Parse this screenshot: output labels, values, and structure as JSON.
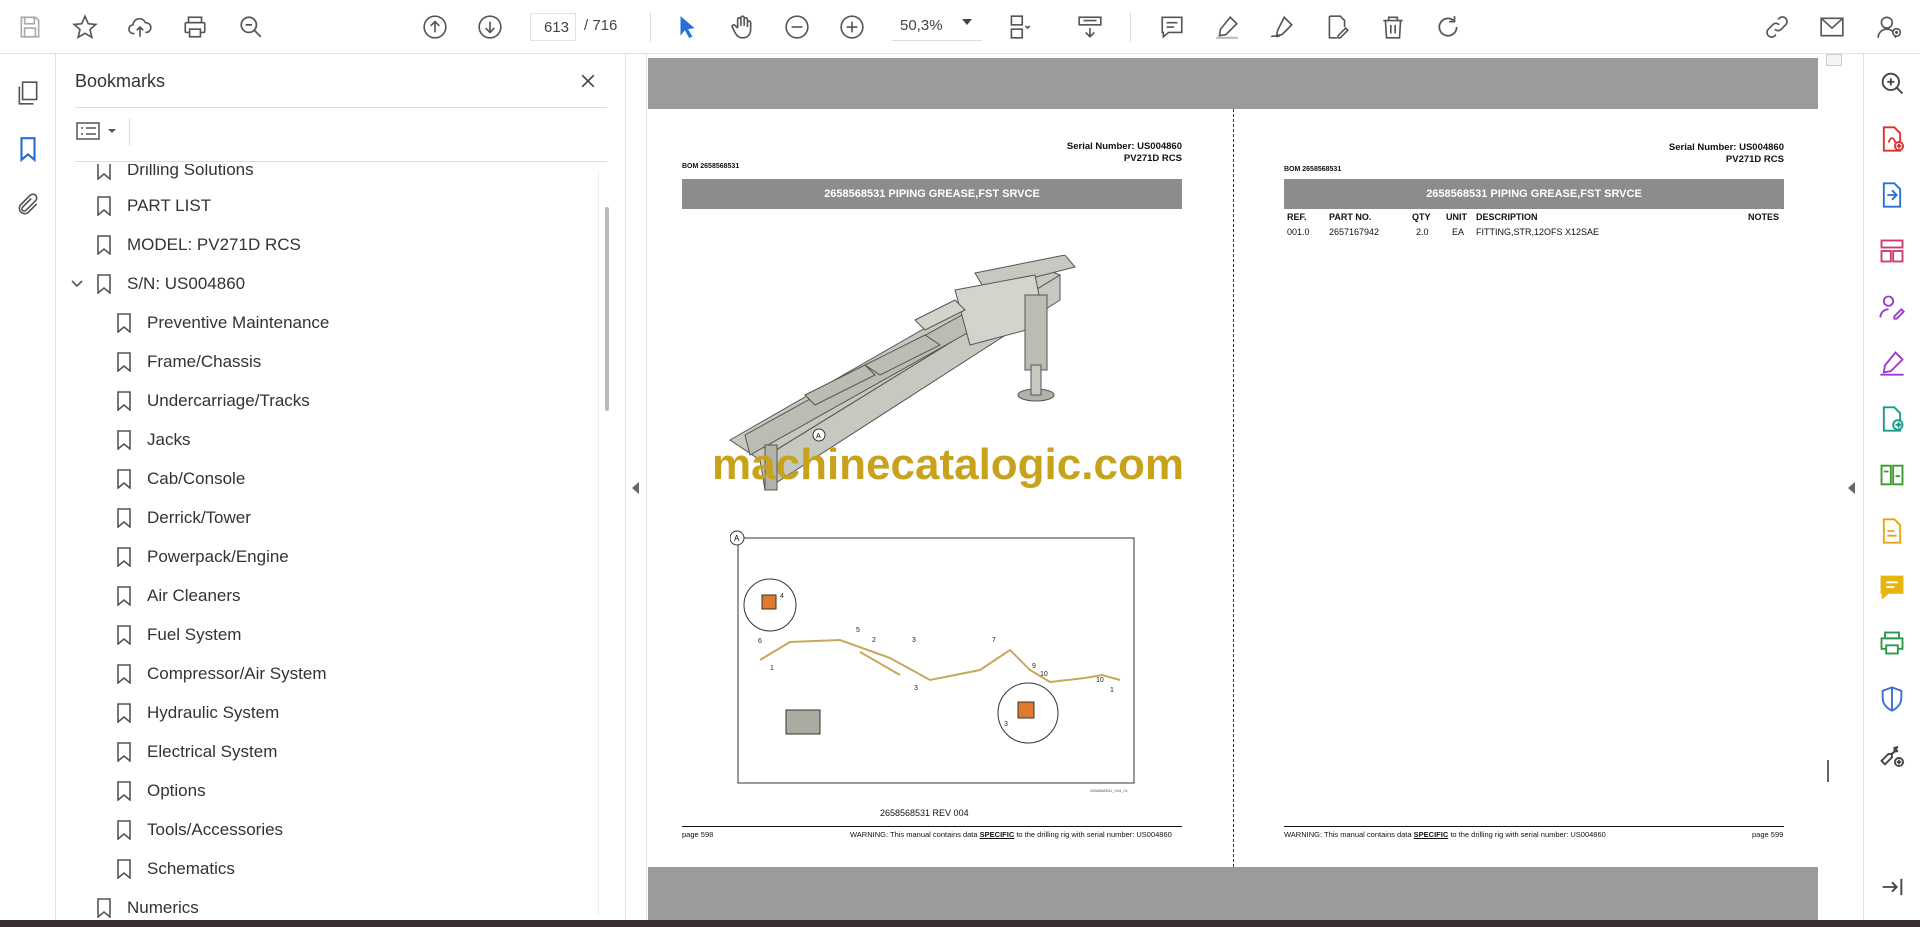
{
  "toolbar": {
    "page_current": "613",
    "page_total": "/ 716",
    "zoom": "50,3%",
    "icons": [
      "save-icon",
      "star-icon",
      "upload-icon",
      "print-icon",
      "find-zoom-icon",
      "page-up-icon",
      "page-down-icon",
      "select-cursor-icon",
      "hand-icon",
      "zoom-out-icon",
      "zoom-in-icon",
      "fit-page-icon",
      "scroll-mode-icon",
      "comment-icon",
      "highlight-icon",
      "sign-icon",
      "edit-pdf-icon",
      "delete-icon",
      "rotate-icon",
      "share-link-icon",
      "email-icon",
      "account-icon"
    ]
  },
  "bookmarks": {
    "title": "Bookmarks",
    "items": [
      {
        "label": "Drilling Solutions",
        "level": 0
      },
      {
        "label": "PART LIST",
        "level": 0
      },
      {
        "label": "MODEL: PV271D RCS",
        "level": 0
      },
      {
        "label": "S/N: US004860",
        "level": 0,
        "expanded": true
      },
      {
        "label": "Preventive Maintenance",
        "level": 1
      },
      {
        "label": "Frame/Chassis",
        "level": 1
      },
      {
        "label": "Undercarriage/Tracks",
        "level": 1
      },
      {
        "label": "Jacks",
        "level": 1
      },
      {
        "label": "Cab/Console",
        "level": 1
      },
      {
        "label": "Derrick/Tower",
        "level": 1
      },
      {
        "label": "Powerpack/Engine",
        "level": 1
      },
      {
        "label": "Air Cleaners",
        "level": 1
      },
      {
        "label": "Fuel System",
        "level": 1
      },
      {
        "label": "Compressor/Air System",
        "level": 1
      },
      {
        "label": "Hydraulic System",
        "level": 1
      },
      {
        "label": "Electrical System",
        "level": 1
      },
      {
        "label": "Options",
        "level": 1
      },
      {
        "label": "Tools/Accessories",
        "level": 1
      },
      {
        "label": "Schematics",
        "level": 1
      },
      {
        "label": "Numerics",
        "level": 0
      }
    ]
  },
  "left_page": {
    "serial": "Serial Number: US004860",
    "model": "PV271D RCS",
    "bom": "BOM 2658568531",
    "banner": "2658568531 PIPING GREASE,FST SRVCE",
    "callout": "A",
    "caption": "2658568531 REV 004",
    "drawing_id": "2658568531_004_01",
    "page_no": "page 598",
    "warning_pre": "WARNING:  This manual contains data ",
    "warning_specific": "SPECIFIC",
    "warning_post": " to the drilling rig with serial number: US004860"
  },
  "right_page": {
    "serial": "Serial Number: US004860",
    "model": "PV271D RCS",
    "bom": "BOM 2658568531",
    "banner": "2658568531 PIPING GREASE,FST SRVCE",
    "columns": {
      "ref": "REF.",
      "part": "PART NO.",
      "qty": "QTY",
      "unit": "UNIT",
      "desc": "DESCRIPTION",
      "notes": "NOTES"
    },
    "rows": [
      {
        "ref": "001.0",
        "part": "2657167942",
        "qty": "2.0",
        "unit": "EA",
        "desc": "FITTING,STR,12OFS X12SAE",
        "notes": ""
      }
    ],
    "page_no": "page 599",
    "warning_pre": "WARNING:  This manual contains data ",
    "warning_specific": "SPECIFIC",
    "warning_post": " to the drilling rig with serial number: US004860"
  },
  "watermark": "machinecatalogic.com",
  "colors": {
    "accent_blue": "#2a6fd6",
    "banner_gray": "#8c8c8c",
    "doc_gray": "#9b9b9b",
    "watermark_gold": "#c9a21c"
  }
}
